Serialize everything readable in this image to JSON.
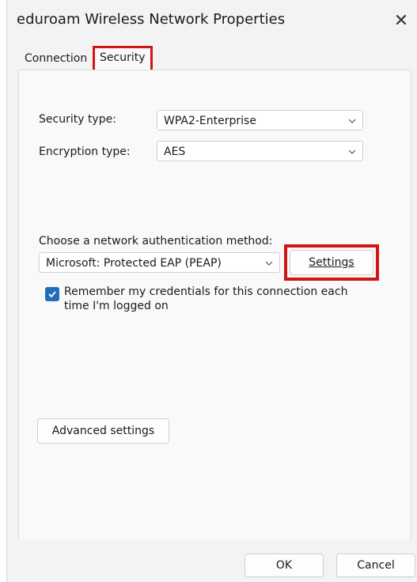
{
  "window": {
    "title": "eduroam Wireless Network Properties",
    "close_glyph": "✕"
  },
  "tabs": [
    {
      "label": "Connection"
    },
    {
      "label": "Security"
    }
  ],
  "security": {
    "security_type_label": "Security type:",
    "security_type_value": "WPA2-Enterprise",
    "encryption_type_label": "Encryption type:",
    "encryption_type_value": "AES",
    "auth_method_label": "Choose a network authentication method:",
    "auth_method_value": "Microsoft: Protected EAP (PEAP)",
    "settings_button": "Settings",
    "remember_checkbox_checked": true,
    "remember_label_line1": "Remember my credentials for this connection each",
    "remember_label_line2": "time I'm logged on",
    "advanced_button": "Advanced settings"
  },
  "footer": {
    "ok": "OK",
    "cancel": "Cancel"
  },
  "colors": {
    "highlight": "#d01515",
    "checkbox": "#1f6fb8"
  }
}
